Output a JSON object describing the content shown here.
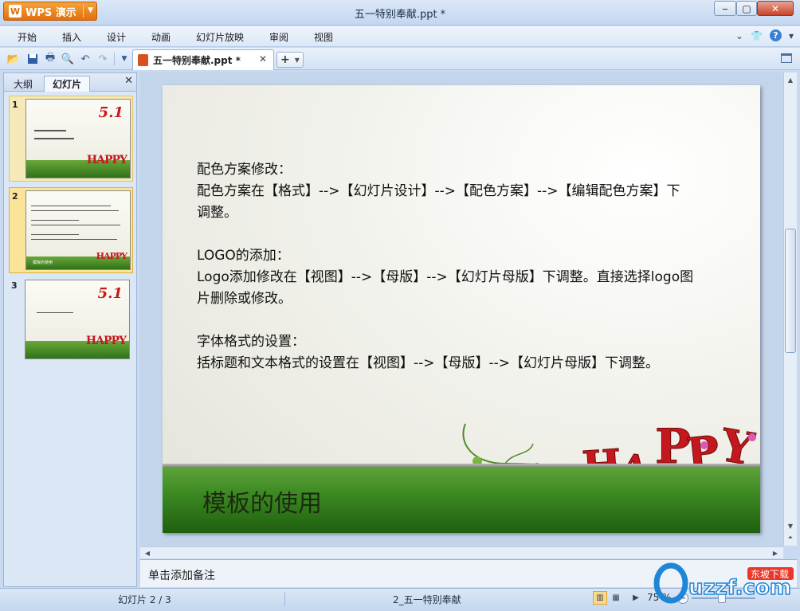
{
  "app": {
    "name": "WPS 演示",
    "doc_title": "五一特别奉献.ppt *"
  },
  "menu": [
    "开始",
    "插入",
    "设计",
    "动画",
    "幻灯片放映",
    "审阅",
    "视图"
  ],
  "toolbar": {
    "doc_tab": "五一特别奉献.ppt *"
  },
  "left_panel": {
    "tabs": [
      "大纲",
      "幻灯片"
    ],
    "slides": [
      {
        "num": "1",
        "title": "5.1"
      },
      {
        "num": "2",
        "title": "模板的使用"
      },
      {
        "num": "3",
        "title": "5.1"
      }
    ]
  },
  "slide": {
    "para1": [
      "配色方案修改：",
      "配色方案在【格式】-->【幻灯片设计】-->【配色方案】-->【编辑配色方案】下",
      "调整。"
    ],
    "para2": [
      "LOGO的添加：",
      "Logo添加修改在【视图】-->【母版】-->【幻灯片母版】下调整。直接选择logo图",
      "片删除或修改。"
    ],
    "para3": [
      "字体格式的设置：",
      "括标题和文本格式的设置在【视图】-->【母版】-->【幻灯片母版】下调整。"
    ],
    "title": "模板的使用",
    "art_text": "HAPPY"
  },
  "notes": {
    "placeholder": "单击添加备注"
  },
  "status": {
    "slide_counter": "幻灯片 2 / 3",
    "template": "2_五一特别奉献",
    "zoom": "75 %"
  },
  "watermark": {
    "text": "uzzf.com",
    "tag": "东坡下载"
  },
  "colors": {
    "accent": "#e0700d",
    "grass": "#3c8a22",
    "art_red": "#c4181e"
  }
}
